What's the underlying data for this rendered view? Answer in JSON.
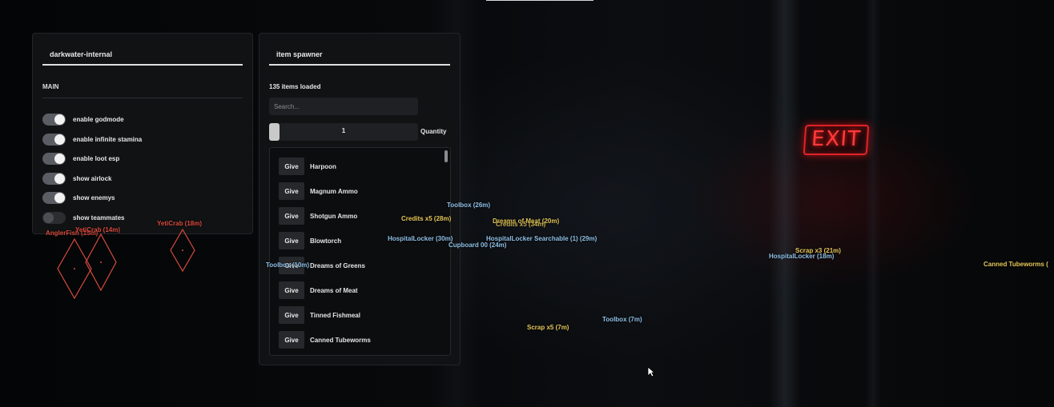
{
  "background": {
    "sign_text": "EXIT"
  },
  "main_panel": {
    "title": "darkwater-internal",
    "section": "MAIN",
    "toggles": [
      {
        "label": "enable godmode",
        "on": true
      },
      {
        "label": "enable infinite stamina",
        "on": true
      },
      {
        "label": "enable loot esp",
        "on": true
      },
      {
        "label": "show airlock",
        "on": true
      },
      {
        "label": "show enemys",
        "on": true
      },
      {
        "label": "show teammates",
        "on": false
      }
    ]
  },
  "spawner_panel": {
    "title": "item spawner",
    "items_loaded": "135 items loaded",
    "search_placeholder": "Search...",
    "quantity_value": "1",
    "quantity_label": "Quantity",
    "give_label": "Give",
    "items": [
      "Harpoon",
      "Magnum Ammo",
      "Shotgun Ammo",
      "Blowtorch",
      "Dreams of Greens",
      "Dreams of Meat",
      "Tinned Fishmeal",
      "Canned Tubeworms"
    ]
  },
  "esp_labels": {
    "toolbox_26": "Toolbox (26m)",
    "credits_28": "Credits x5 (28m)",
    "dreams_meat_20": "Dreams of Meat (20m)",
    "credits_34": "Credits x5 (34m)",
    "hospital_30": "HospitalLocker (30m)",
    "hospital_searchable_29": "HospitalLocker Searchable (1) (29m)",
    "cupboard_24": "Cupboard 00 (24m)",
    "toolbox_10": "Toolbox (10m)",
    "scrap_21": "Scrap x3 (21m)",
    "hospital_18": "HospitalLocker (18m)",
    "canned_tubeworms": "Canned Tubeworms (",
    "toolbox_7": "Toolbox (7m)",
    "scrap_7": "Scrap x5 (7m)"
  },
  "enemy_labels": {
    "anglerfish": "AnglerFish (15m)",
    "yeticrab_14": "YetiCrab (14m)",
    "yeticrab_18": "YetiCrab (18m)"
  },
  "colors": {
    "loot": "#e6c85a",
    "locker": "#8fc0e6",
    "enemy": "#d94a3e",
    "exit_sign": "#ff3a3a"
  }
}
